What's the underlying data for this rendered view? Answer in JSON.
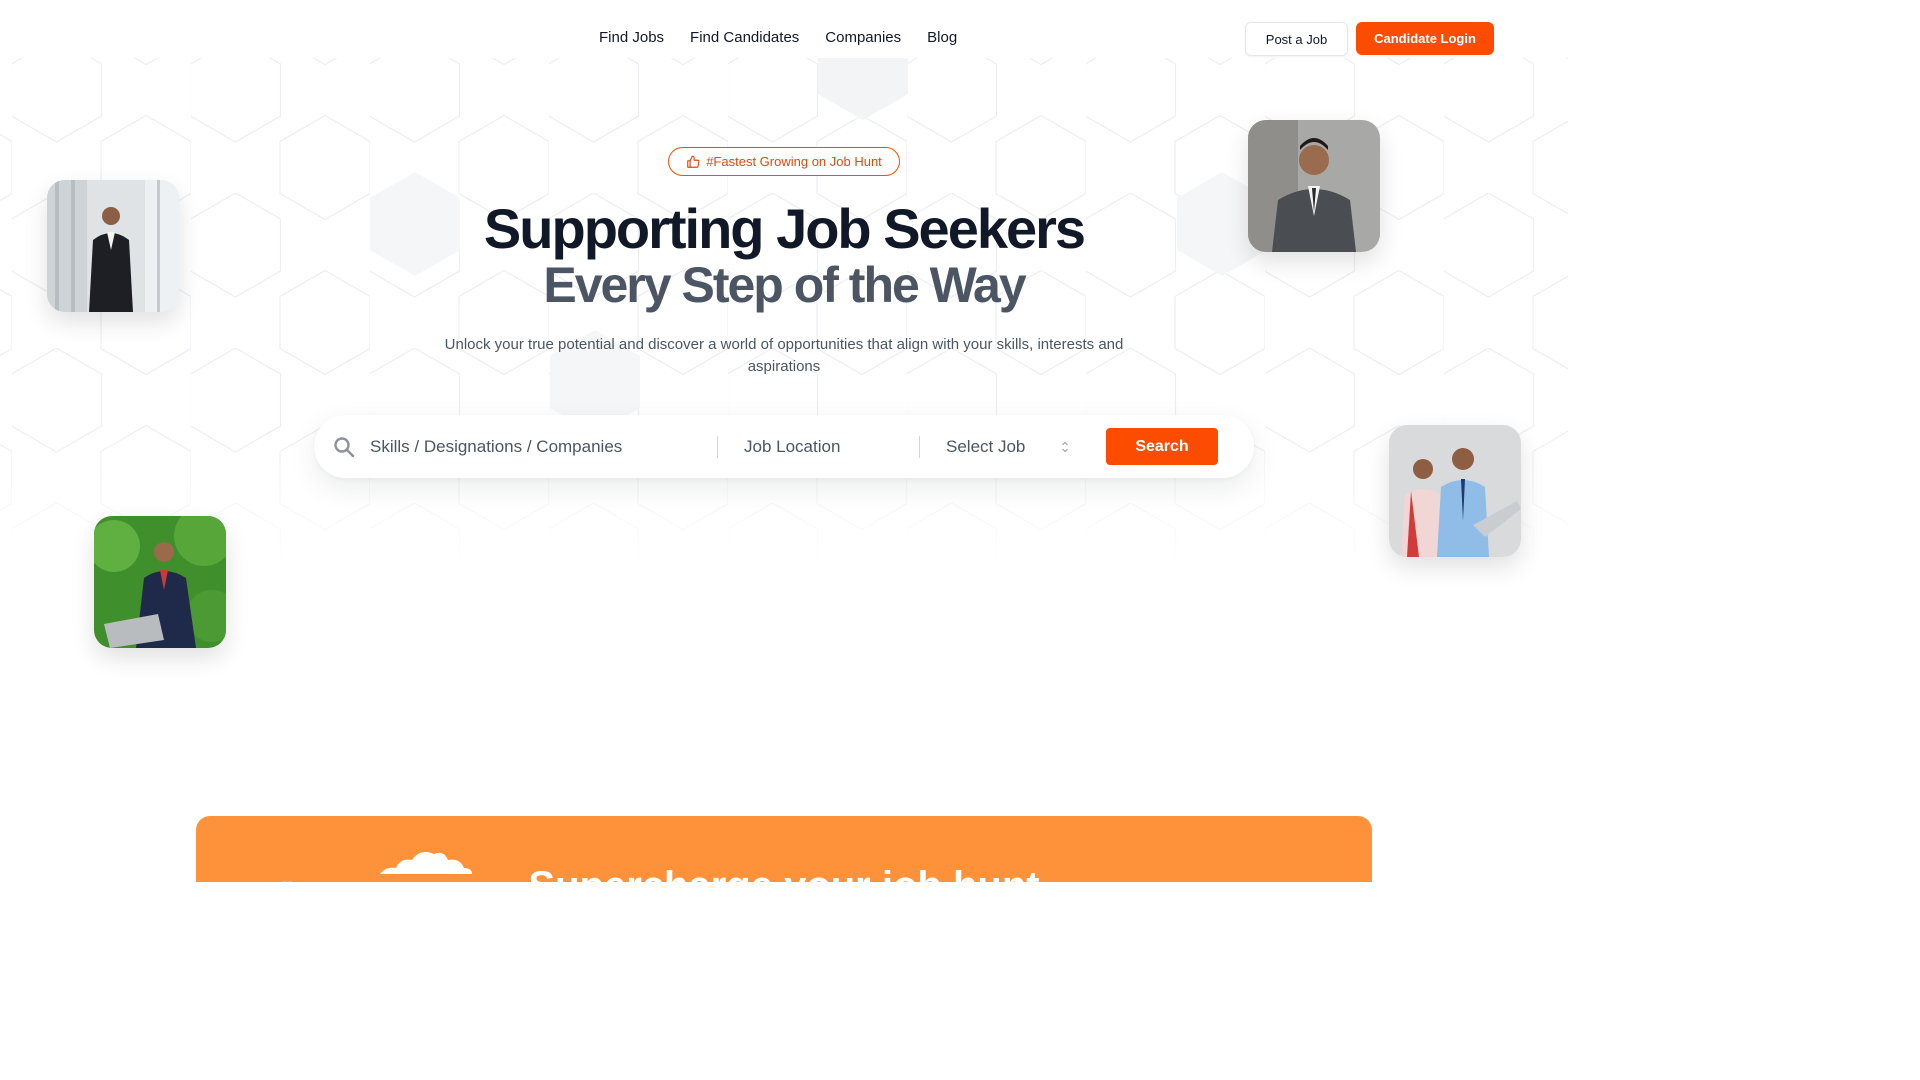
{
  "nav": {
    "links": [
      "Find Jobs",
      "Find Candidates",
      "Companies",
      "Blog"
    ],
    "post_job": "Post a Job",
    "candidate_login": "Candidate Login"
  },
  "hero": {
    "badge": "#Fastest Growing on Job Hunt",
    "badge_icon": "thumbs-up-icon",
    "title_line1": "Supporting Job Seekers",
    "title_line2": "Every Step of the Way",
    "subtitle": "Unlock your true potential and discover a world of opportunities that align with your skills, interests and aspirations"
  },
  "search": {
    "skills_placeholder": "Skills / Designations / Companies",
    "location_placeholder": "Job Location",
    "select_label": "Select Job",
    "button": "Search",
    "icon": "search-icon"
  },
  "banner": {
    "title": "Supercharge your job hunt"
  },
  "colors": {
    "accent": "#fc4c02",
    "banner": "#fd923b",
    "heading": "#111827",
    "heading_secondary": "#4b5563"
  }
}
